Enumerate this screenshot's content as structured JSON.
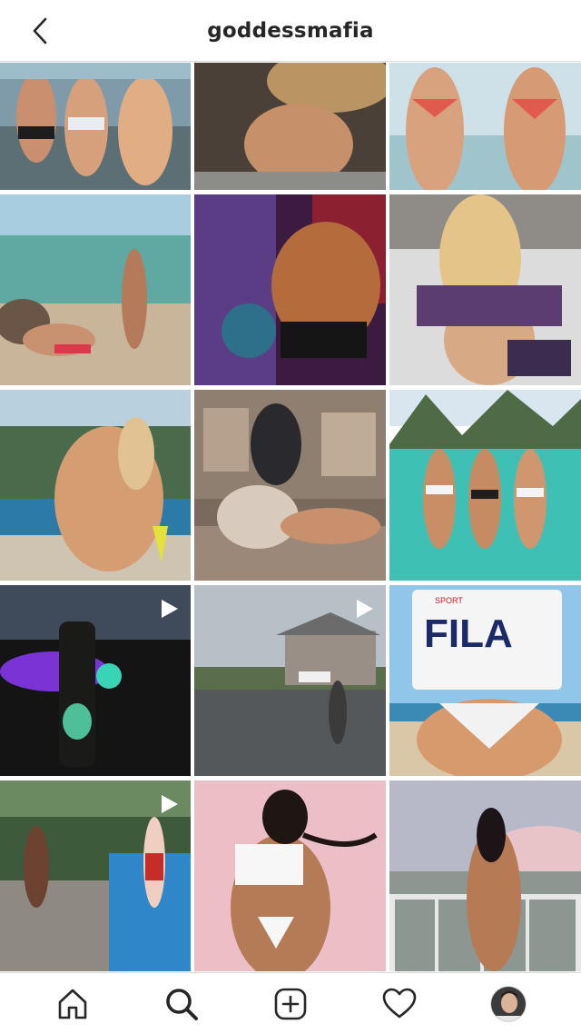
{
  "header": {
    "title": "goddessmafia",
    "back_icon": "chevron-left-icon"
  },
  "grid": {
    "tiles": [
      {
        "id": 1,
        "video": false
      },
      {
        "id": 2,
        "video": false
      },
      {
        "id": 3,
        "video": false
      },
      {
        "id": 4,
        "video": false
      },
      {
        "id": 5,
        "video": false
      },
      {
        "id": 6,
        "video": false
      },
      {
        "id": 7,
        "video": false
      },
      {
        "id": 8,
        "video": false
      },
      {
        "id": 9,
        "video": false
      },
      {
        "id": 10,
        "video": true
      },
      {
        "id": 11,
        "video": true
      },
      {
        "id": 12,
        "video": false,
        "shirt_text": "FILA",
        "shirt_small_text": "SPORT"
      },
      {
        "id": 13,
        "video": true
      },
      {
        "id": 14,
        "video": false
      },
      {
        "id": 15,
        "video": false
      }
    ]
  },
  "tabbar": {
    "tabs": [
      {
        "icon": "home-icon"
      },
      {
        "icon": "search-icon",
        "active": true
      },
      {
        "icon": "new-post-icon"
      },
      {
        "icon": "heart-icon"
      },
      {
        "icon": "profile-avatar"
      }
    ]
  },
  "colors": {
    "border": "#dbdbdb",
    "text": "#262626",
    "background": "#ffffff"
  }
}
